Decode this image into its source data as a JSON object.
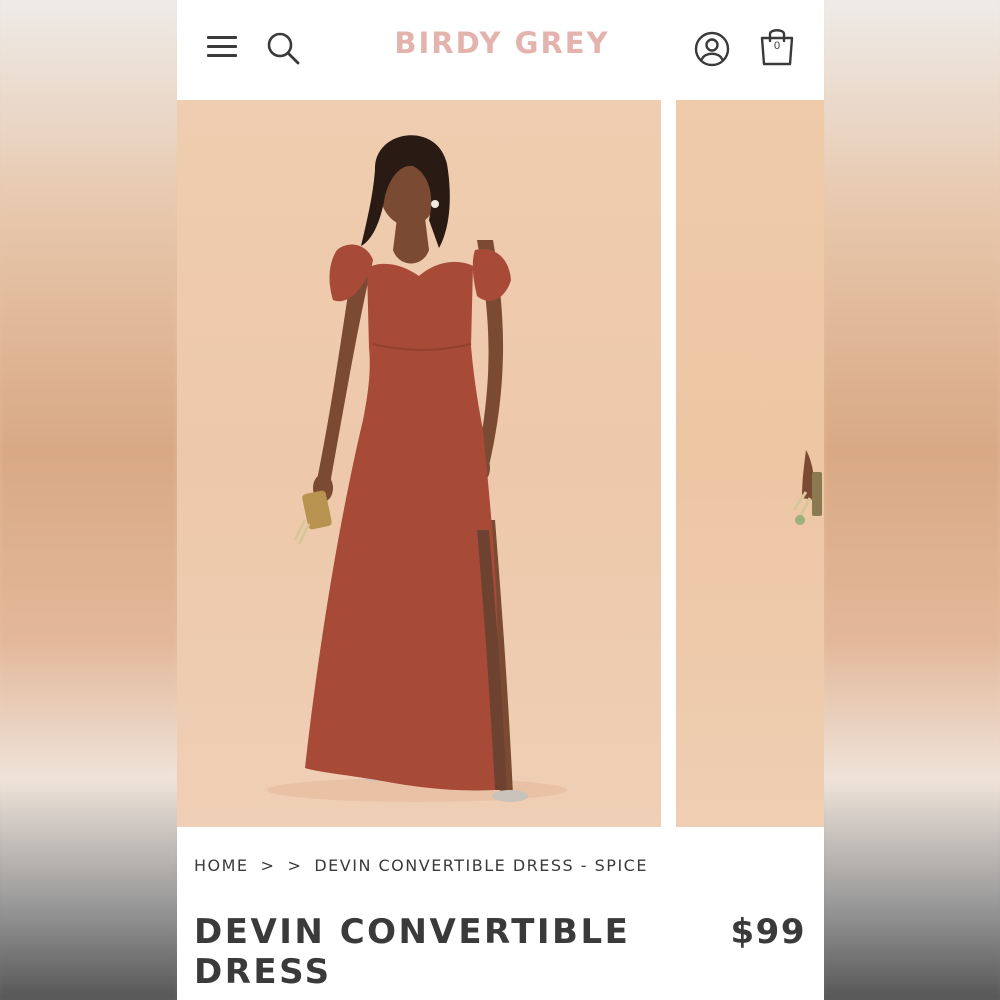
{
  "header": {
    "brand": "BIRDY GREY",
    "cart_count": "0",
    "brand_color": "#e3b3ad"
  },
  "breadcrumb": {
    "home": "HOME",
    "separator": ">",
    "current": "DEVIN CONVERTIBLE DRESS - SPICE"
  },
  "product": {
    "title_line1": "DEVIN CONVERTIBLE",
    "title_line2": "DRESS",
    "price": "$99",
    "dress_color": "#a84a38",
    "background_color": "#efcaab"
  },
  "icons": {
    "menu": "hamburger-menu-icon",
    "search": "search-icon",
    "account": "account-icon",
    "cart": "shopping-bag-icon"
  }
}
